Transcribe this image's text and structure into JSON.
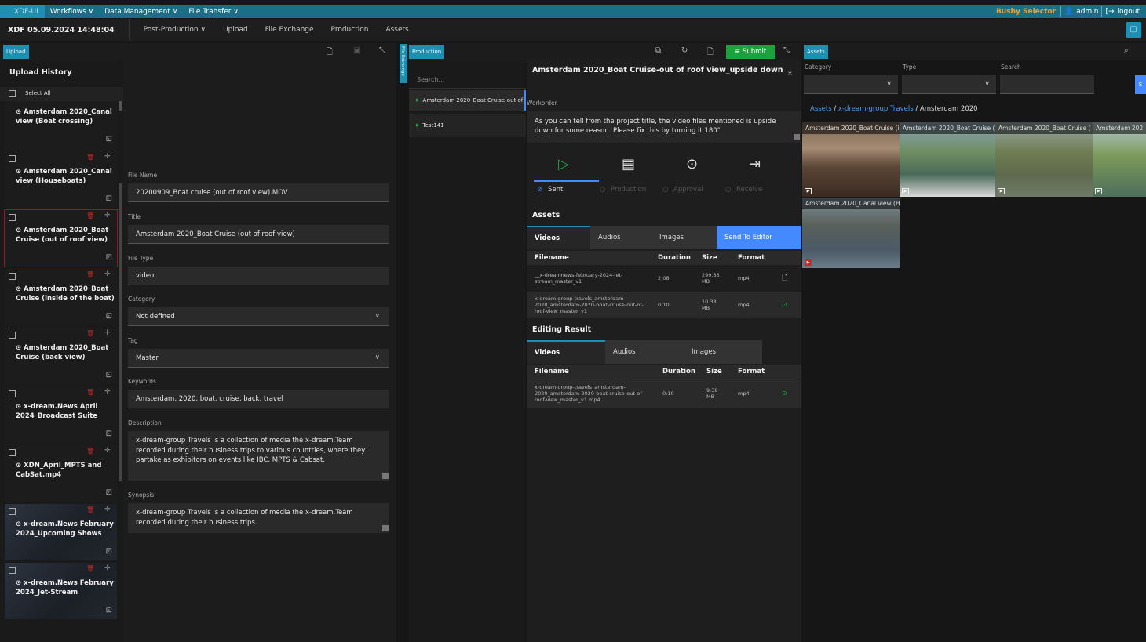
{
  "topbar": {
    "brand": "XDF-UI",
    "menus": [
      "Workflows ∨",
      "Data Management ∨",
      "File Transfer ∨"
    ],
    "busby": "Busby Selector",
    "user": "admin",
    "logout": "logout"
  },
  "secbar": {
    "clock": "XDF 05.09.2024 14:48:04",
    "nav": [
      "Post-Production ∨",
      "Upload",
      "File Exchange",
      "Production",
      "Assets"
    ]
  },
  "upload": {
    "tag": "Upload",
    "history_title": "Upload History",
    "select_all": "Select All",
    "cards": [
      "Amsterdam 2020_Canal view (Boat crossing)",
      "Amsterdam 2020_Canal view (Houseboats)",
      "Amsterdam 2020_Boat Cruise (out of roof view)",
      "Amsterdam 2020_Boat Cruise (inside of the boat)",
      "Amsterdam 2020_Boat Cruise (back view)",
      "x-dream.News April 2024_Broadcast Suite",
      "XDN_April_MPTS and CabSat.mp4",
      "x-dream.News February 2024_Upcoming Shows",
      "x-dream.News February 2024_Jet-Stream"
    ]
  },
  "form": {
    "file_name_label": "File Name",
    "file_name": "20200909_Boat cruise (out of roof view).MOV",
    "title_label": "Title",
    "title": "Amsterdam 2020_Boat Cruise (out of roof view)",
    "file_type_label": "File Type",
    "file_type": "video",
    "category_label": "Category",
    "category": "Not defined",
    "tag_label": "Tag",
    "tag": "Master",
    "keywords_label": "Keywords",
    "keywords": "Amsterdam, 2020, boat, cruise, back, travel",
    "description_label": "Description",
    "description": "x-dream-group Travels is a collection of media the x-dream.Team recorded during their business trips to various countries, where they partake as exhibitors on events like IBC, MPTS & Cabsat.",
    "synopsis_label": "Synopsis",
    "synopsis": "x-dream-group Travels is a collection of media the x-dream.Team recorded during their business trips."
  },
  "file_exchange_tab": "File Exchange",
  "production": {
    "tag": "Production",
    "submit": "Submit",
    "search_placeholder": "Search...",
    "list": [
      "Amsterdam 2020_Boat Cruise-out of",
      "Test141"
    ],
    "detail_title": "Amsterdam 2020_Boat Cruise-out of roof view_upside down",
    "workorder_label": "Workorder",
    "workorder": "As you can tell from the project title, the video files mentioned is upside down for some reason. Please fix this by turning it 180°",
    "steps": [
      "Sent",
      "Production",
      "Approval",
      "Receive"
    ],
    "assets_title": "Assets",
    "asset_tabs": [
      "Videos",
      "Audios",
      "Images",
      "Send To Editor"
    ],
    "asset_headers": [
      "Filename",
      "Duration",
      "Size",
      "Format"
    ],
    "asset_rows": [
      {
        "name": "__x-dreamnews-february-2024-jet-stream_master_v1",
        "duration": "2:08",
        "size": "299.83 MB",
        "format": "mp4"
      },
      {
        "name": "x-dream-group-travels_amsterdam-2020_amsterdam-2020-boat-cruise-out-of-roof-view_master_v1",
        "duration": "0:10",
        "size": "10.38 MB",
        "format": "mp4"
      }
    ],
    "editing_title": "Editing Result",
    "edit_tabs": [
      "Videos",
      "Audios",
      "Images"
    ],
    "edit_headers": [
      "Filename",
      "Duration",
      "Size",
      "Format"
    ],
    "edit_rows": [
      {
        "name": "x-dream-group-travels_amsterdam-2020_amsterdam-2020-boat-cruise-out-of-roof-view_master_v1.mp4",
        "duration": "0:10",
        "size": "9.38 MB",
        "format": "mp4"
      }
    ]
  },
  "assets": {
    "tag": "Assets",
    "category_label": "Category",
    "type_label": "Type",
    "search_label": "Search",
    "search_button": "S",
    "breadcrumb": [
      "Assets",
      "x-dream-group Travels",
      "Amsterdam 2020"
    ],
    "thumbs": [
      "Amsterdam 2020_Boat Cruise (i",
      "Amsterdam 2020_Boat Cruise (",
      "Amsterdam 2020_Boat Cruise (",
      "Amsterdam 202",
      "Amsterdam 2020_Canal view (H"
    ]
  },
  "colors": {
    "accent": "#1f8fb1",
    "submit": "#1aa33c",
    "busby": "#f0a030",
    "danger": "#c12a2a",
    "success": "#1aa33c"
  }
}
